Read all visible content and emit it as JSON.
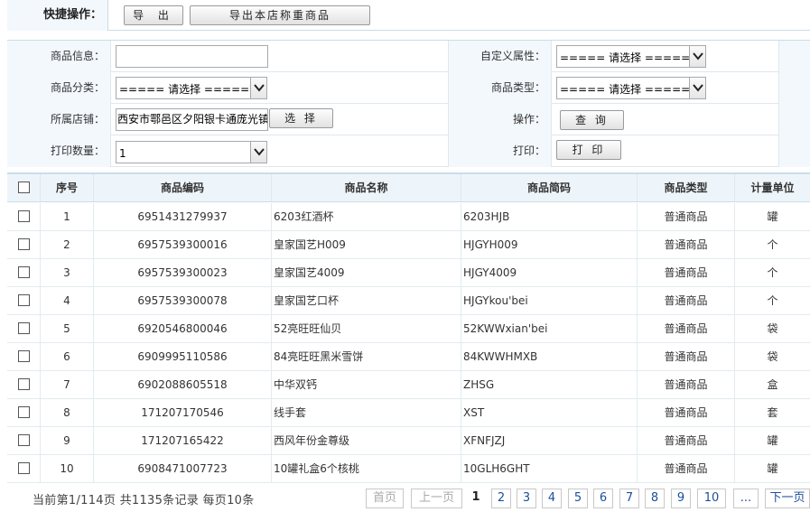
{
  "quick_ops": {
    "label": "快捷操作：",
    "export_label": "导 出",
    "export_weight_label": "导出本店称重商品"
  },
  "form": {
    "product_info_label": "商品信息：",
    "product_info_value": "",
    "custom_attr_label": "自定义属性：",
    "custom_attr_value": "===== 请选择 =====",
    "category_label": "商品分类：",
    "category_value": "===== 请选择 =====",
    "type_label": "商品类型：",
    "type_value": "===== 请选择 =====",
    "store_label": "所属店铺：",
    "store_value": "西安市鄠邑区夕阳银卡通庞光镇",
    "choose_label": "选 择",
    "operation_label": "操作：",
    "query_label": "查 询",
    "print_count_label": "打印数量：",
    "print_count_value": "1",
    "print_label": "打印：",
    "print_button_label": "打 印"
  },
  "table": {
    "headers": [
      "序号",
      "商品编码",
      "商品名称",
      "商品简码",
      "商品类型",
      "计量单位"
    ],
    "rows": [
      {
        "index": "1",
        "code": "6951431279937",
        "name": "6203红酒杯",
        "short": "6203HJB",
        "type": "普通商品",
        "unit": "罐"
      },
      {
        "index": "2",
        "code": "6957539300016",
        "name": "皇家国艺H009",
        "short": "HJGYH009",
        "type": "普通商品",
        "unit": "个"
      },
      {
        "index": "3",
        "code": "6957539300023",
        "name": "皇家国艺4009",
        "short": "HJGY4009",
        "type": "普通商品",
        "unit": "个"
      },
      {
        "index": "4",
        "code": "6957539300078",
        "name": "皇家国艺口杯",
        "short": "HJGYkou'bei",
        "type": "普通商品",
        "unit": "个"
      },
      {
        "index": "5",
        "code": "6920546800046",
        "name": "52亮旺旺仙贝",
        "short": "52KWWxian'bei",
        "type": "普通商品",
        "unit": "袋"
      },
      {
        "index": "6",
        "code": "6909995110586",
        "name": "84亮旺旺黑米雪饼",
        "short": "84KWWHMXB",
        "type": "普通商品",
        "unit": "袋"
      },
      {
        "index": "7",
        "code": "6902088605518",
        "name": "中华双钙",
        "short": "ZHSG",
        "type": "普通商品",
        "unit": "盒"
      },
      {
        "index": "8",
        "code": "171207170546",
        "name": "线手套",
        "short": "XST",
        "type": "普通商品",
        "unit": "套"
      },
      {
        "index": "9",
        "code": "171207165422",
        "name": "西风年份金尊级",
        "short": "XFNFJZJ",
        "type": "普通商品",
        "unit": "罐"
      },
      {
        "index": "10",
        "code": "6908471007723",
        "name": "10罐礼盒6个核桃",
        "short": "10GLH6GHT",
        "type": "普通商品",
        "unit": "罐"
      }
    ]
  },
  "pager": {
    "info": "当前第1/114页 共1135条记录 每页10条",
    "first": "首页",
    "prev": "上一页",
    "pages": [
      "1",
      "2",
      "3",
      "4",
      "5",
      "6",
      "7",
      "8",
      "9",
      "10"
    ],
    "current": "1",
    "ellipsis": "...",
    "next": "下一页"
  },
  "icons": {
    "dropdown": "chevron-down-icon"
  },
  "colors": {
    "border": "#c9dde8",
    "header_bg": "#eef5fa",
    "label_bg": "#f3f8fc",
    "link": "#1a4f9c"
  }
}
